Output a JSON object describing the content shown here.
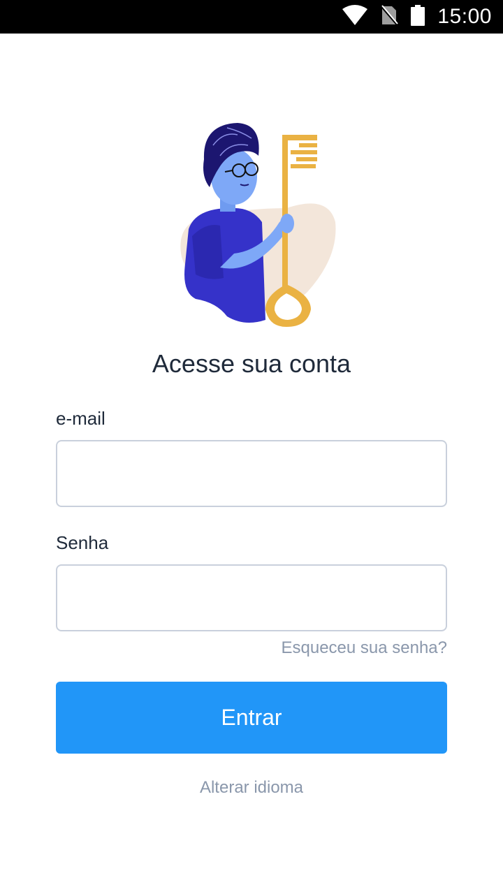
{
  "status_bar": {
    "time": "15:00",
    "icons": [
      "wifi-icon",
      "no-sim-icon",
      "battery-icon"
    ]
  },
  "login": {
    "title": "Acesse sua conta",
    "email_label": "e-mail",
    "email_value": "",
    "password_label": "Senha",
    "password_value": "",
    "forgot_password": "Esqueceu sua senha?",
    "submit_label": "Entrar",
    "change_language": "Alterar idioma"
  },
  "colors": {
    "primary": "#2196f8",
    "text": "#1f2a3a",
    "muted": "#8a97ab",
    "input_border": "#c9d0dc",
    "status_bar": "#000000"
  }
}
